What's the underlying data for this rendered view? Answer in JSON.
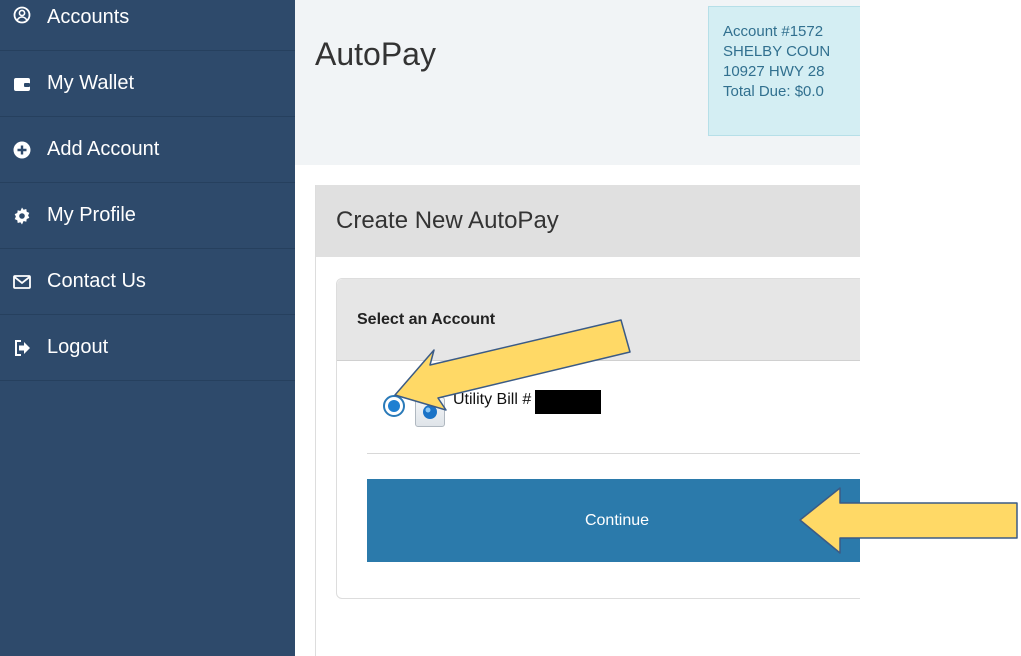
{
  "sidebar": {
    "items": [
      {
        "label": "Accounts",
        "icon": "user-circle-icon"
      },
      {
        "label": "My Wallet",
        "icon": "wallet-icon"
      },
      {
        "label": "Add Account",
        "icon": "plus-circle-icon"
      },
      {
        "label": "My Profile",
        "icon": "gear-icon"
      },
      {
        "label": "Contact Us",
        "icon": "envelope-icon"
      },
      {
        "label": "Logout",
        "icon": "logout-icon"
      }
    ]
  },
  "header": {
    "title": "AutoPay",
    "account": {
      "number": "Account #1572",
      "name": "SHELBY COUN",
      "address": "10927 HWY 28",
      "total_due": "Total Due: $0.0"
    }
  },
  "panel": {
    "heading": "Create New AutoPay",
    "card_heading": "Select an Account",
    "option_label": "Utility Bill #",
    "option_selected": true,
    "continue_label": "Continue"
  },
  "colors": {
    "sidebar": "#2e4a6b",
    "button": "#2b7aab",
    "info_box": "#d4eef3",
    "annotation_arrow": "#ffd966"
  }
}
